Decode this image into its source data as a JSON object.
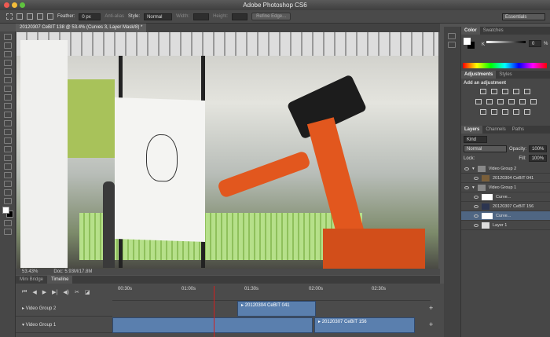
{
  "app": {
    "title": "Adobe Photoshop CS6"
  },
  "options": {
    "feather_label": "Feather:",
    "feather_value": "0 px",
    "antialias": "Anti-alias",
    "style_label": "Style:",
    "style_value": "Normal",
    "width_label": "Width:",
    "height_label": "Height:",
    "refine_edge": "Refine Edge...",
    "workspace": "Essentials"
  },
  "document": {
    "tab": "20120307 CeBIT 138 @ 53.4% (Curves 3, Layer Mask/8) *",
    "zoom": "53.43%",
    "doc_size": "Doc: 5.93M/17.8M"
  },
  "bottom_tabs": [
    "Mini Bridge",
    "Timeline"
  ],
  "timeline": {
    "ruler": [
      "00:30s",
      "01:00s",
      "01:30s",
      "02:00s",
      "02:30s"
    ],
    "playhead_progress": 0.58,
    "tracks": [
      {
        "name": "Video Group 2",
        "clips": [
          "20120304 CeBIT 041"
        ]
      },
      {
        "name": "Video Group 1",
        "clips": [
          "",
          "20120307 CeBIT 156"
        ]
      }
    ]
  },
  "color_panel": {
    "tabs": [
      "Color",
      "Swatches"
    ],
    "k_label": "K",
    "k_value": "0",
    "unit": "%"
  },
  "adjustments_panel": {
    "tabs": [
      "Adjustments",
      "Styles"
    ],
    "heading": "Add an adjustment"
  },
  "layers_panel": {
    "tabs": [
      "Layers",
      "Channels",
      "Paths"
    ],
    "filter": "Kind",
    "blend_mode": "Normal",
    "opacity_label": "Opacity:",
    "opacity": "100%",
    "lock_label": "Lock:",
    "fill_label": "Fill:",
    "fill": "100%",
    "layers": [
      {
        "name": "Video Group 2",
        "type": "group"
      },
      {
        "name": "20120304 CeBIT 041",
        "type": "video"
      },
      {
        "name": "Video Group 1",
        "type": "group"
      },
      {
        "name": "Curve...",
        "type": "adjustment"
      },
      {
        "name": "20120307 CeBIT 156",
        "type": "video"
      },
      {
        "name": "Curve...",
        "type": "adjustment",
        "selected": true
      },
      {
        "name": "Layer 1",
        "type": "video"
      }
    ]
  },
  "colors": {
    "accent": "#5a7fae",
    "playhead": "#d02020",
    "robot": "#e2571e"
  }
}
